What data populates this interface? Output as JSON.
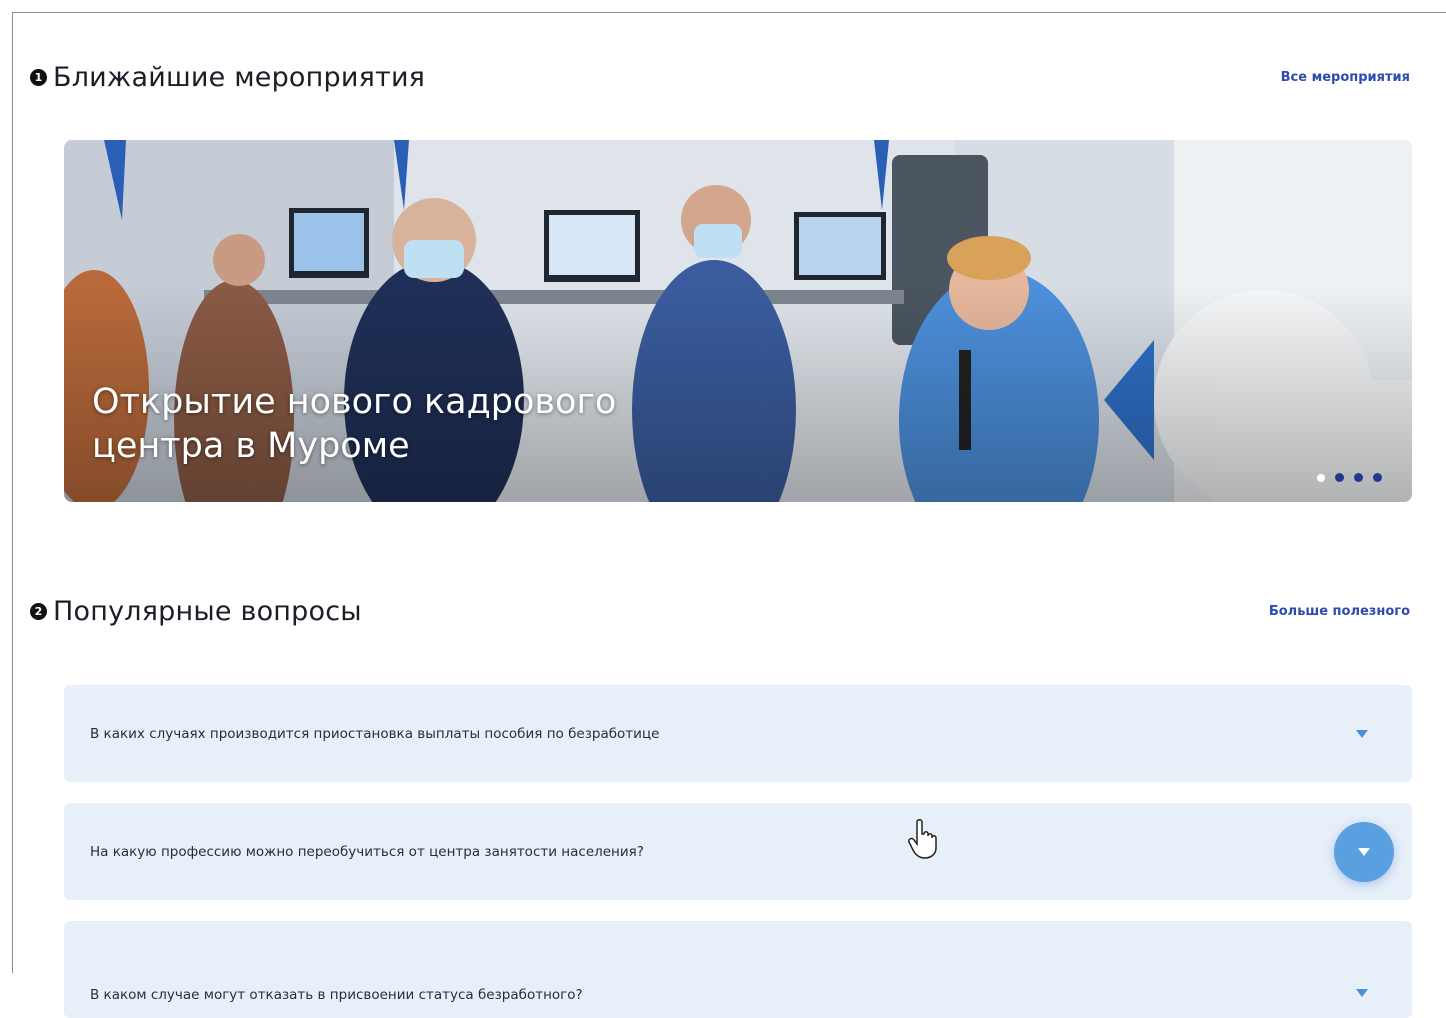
{
  "events": {
    "marker": "1",
    "title": "Ближайшие мероприятия",
    "link": "Все мероприятия",
    "slide_caption_line1": "Открытие нового кадрового",
    "slide_caption_line2": "центра в Муроме",
    "slides_count": 4,
    "active_slide": 1
  },
  "faq": {
    "marker": "2",
    "title": "Популярные вопросы",
    "link": "Больше полезного",
    "items": [
      {
        "question": "В каких случаях производится приостановка выплаты пособия по безработице",
        "toggle": "chevron-down-icon"
      },
      {
        "question": "На какую профессию можно переобучиться от центра занятости населения?",
        "toggle": "chevron-down-icon",
        "hovered": true
      },
      {
        "question": "В каком случае могут отказать в присвоении статуса безработного?",
        "toggle": "chevron-down-icon"
      }
    ]
  },
  "colors": {
    "accent": "#2d4cae",
    "faq_bg": "#e7eff9",
    "toggle_hover": "#5a9fe0",
    "chevron": "#4a90d9"
  }
}
